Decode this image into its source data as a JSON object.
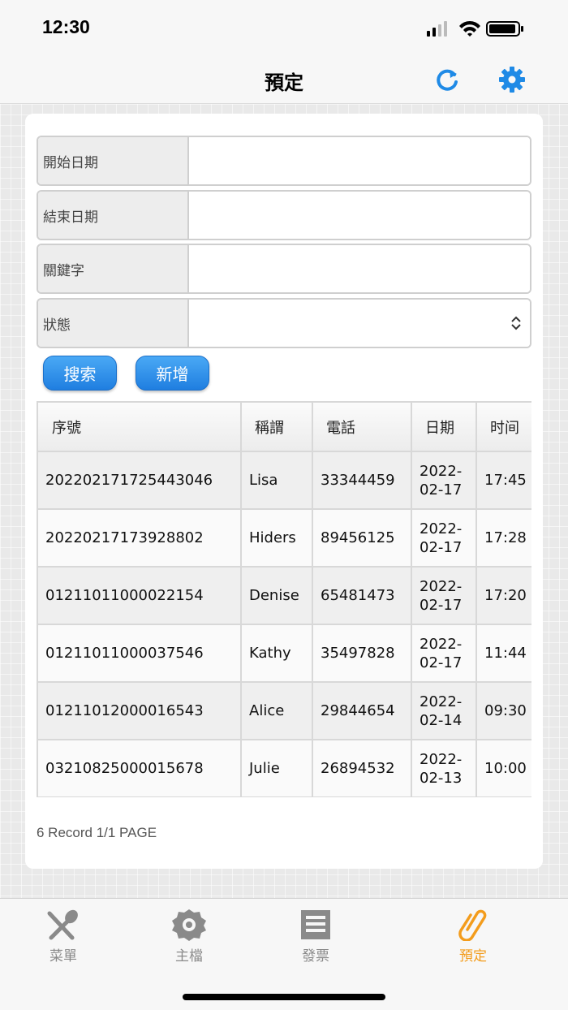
{
  "status_bar": {
    "time": "12:30"
  },
  "nav": {
    "title": "預定"
  },
  "form": {
    "start_date_label": "開始日期",
    "end_date_label": "結束日期",
    "keyword_label": "關鍵字",
    "status_label": "狀態",
    "start_date_value": "",
    "end_date_value": "",
    "keyword_value": "",
    "status_value": ""
  },
  "buttons": {
    "search": "搜索",
    "add": "新增"
  },
  "table": {
    "headers": [
      "序號",
      "稱謂",
      "電話",
      "日期",
      "时间"
    ],
    "rows": [
      [
        "20220217172544304​6",
        "Lisa",
        "33344459",
        "2022-02-17",
        "17:45"
      ],
      [
        "20220217173928802",
        "Hiders",
        "89456125",
        "2022-02-17",
        "17:28"
      ],
      [
        "01211011000022154",
        "Denise",
        "65481473",
        "2022-02-17",
        "17:20"
      ],
      [
        "01211011000037546",
        "Kathy",
        "35497828",
        "2022-02-17",
        "11:44"
      ],
      [
        "01211012000016543",
        "Alice",
        "29844654",
        "2022-02-14",
        "09:30"
      ],
      [
        "03210825000015678",
        "Julie",
        "26894532",
        "2022-02-13",
        "10:00"
      ]
    ]
  },
  "footer": {
    "record_info": "6 Record 1/1 PAGE"
  },
  "tabs": [
    {
      "label": "菜單",
      "icon": "fork-spoon-icon"
    },
    {
      "label": "主檔",
      "icon": "gear-icon"
    },
    {
      "label": "發票",
      "icon": "receipt-icon"
    },
    {
      "label": "預定",
      "icon": "paperclip-icon"
    }
  ],
  "colors": {
    "accent_blue": "#1f8ae6",
    "active_orange": "#f39c1c",
    "inactive_gray": "#8a8a8a"
  }
}
